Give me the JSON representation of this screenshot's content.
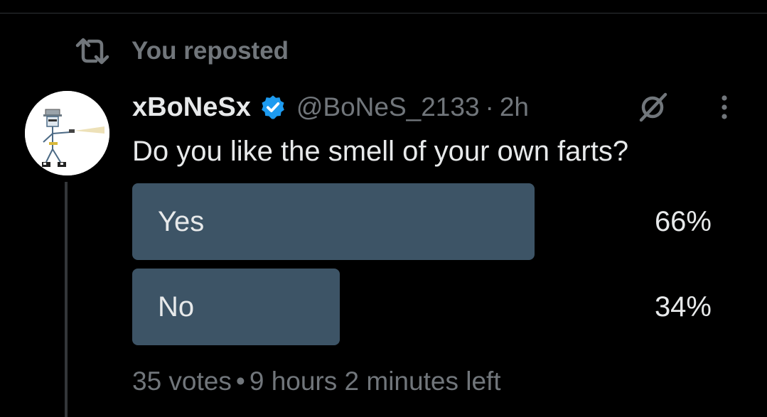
{
  "repost": {
    "label": "You reposted",
    "icon": "repost-icon"
  },
  "post": {
    "display_name": "xBoNeSx",
    "verified": true,
    "handle": "@BoNeS_2133",
    "separator": "·",
    "timestamp": "2h",
    "question": "Do you like the smell of your own farts?",
    "icons": [
      "verified-badge-icon",
      "grok-icon",
      "more-icon"
    ]
  },
  "poll": {
    "options": [
      {
        "label": "Yes",
        "percent_label": "66%",
        "fraction": 0.66
      },
      {
        "label": "No",
        "percent_label": "34%",
        "fraction": 0.34
      }
    ],
    "votes": "35 votes",
    "footer_separator": "•",
    "time_left": "9 hours 2 minutes left"
  },
  "colors": {
    "background": "#000000",
    "text_primary": "#e7e9ea",
    "text_secondary": "#71767b",
    "poll_bar": "#3d5466",
    "verified_blue": "#1d9bf0"
  }
}
